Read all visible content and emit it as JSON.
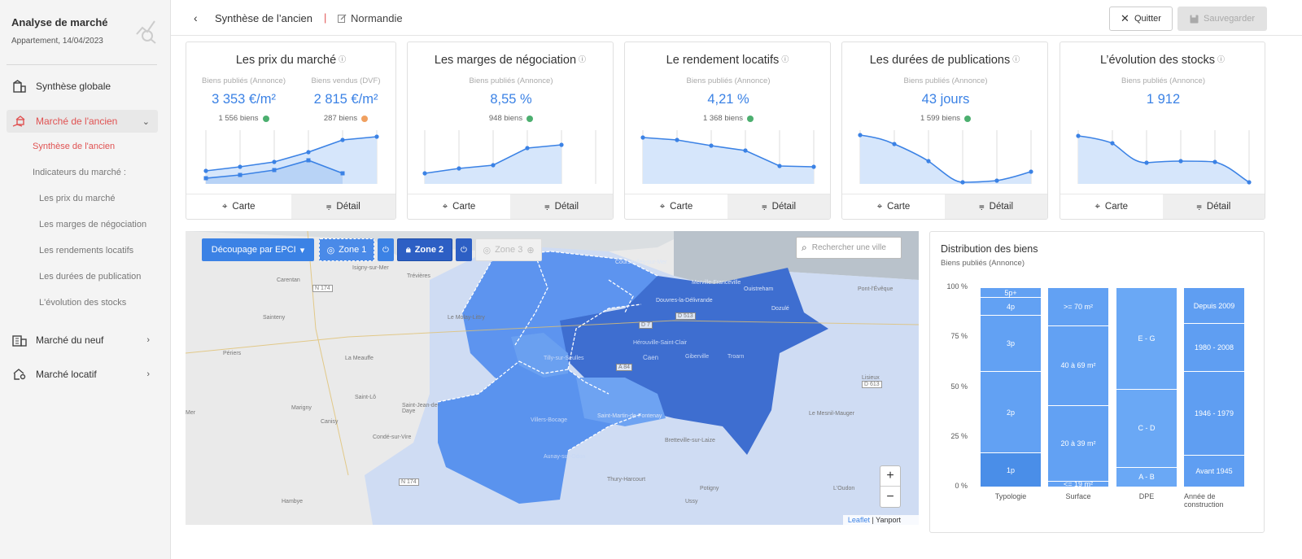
{
  "sidebar": {
    "app_title": "Analyse de marché",
    "app_subtitle": "Appartement, 14/04/2023",
    "items": [
      {
        "label": "Synthèse globale",
        "icon": "building-icon"
      },
      {
        "label": "Marché de l'ancien",
        "icon": "house-hand-icon",
        "active": true
      },
      {
        "label": "Marché du neuf",
        "icon": "city-icon"
      },
      {
        "label": "Marché locatif",
        "icon": "house-key-icon"
      }
    ],
    "sub_active": "Synthèse de l'ancien",
    "sub_header": "Indicateurs du marché :",
    "sub_items": [
      "Les prix du marché",
      "Les marges de négociation",
      "Les rendements locatifs",
      "Les durées de publication",
      "L'évolution des stocks"
    ]
  },
  "header": {
    "back_icon": "chevron-left-icon",
    "title": "Synthèse de l’ancien",
    "separator": "|",
    "region": "Normandie",
    "quit_label": "Quitter",
    "save_label": "Sauvegarder"
  },
  "cards": [
    {
      "title": "Les prix du marché",
      "cols": [
        {
          "label": "Biens publiés (Annonce)",
          "value": "3 353 €/m²",
          "count": "1 556 biens",
          "dot": "#4caf6f"
        },
        {
          "label": "Biens vendus (DVF)",
          "value": "2 815 €/m²",
          "count": "287 biens",
          "dot": "#f0a060"
        }
      ]
    },
    {
      "title": "Les marges de négociation",
      "cols": [
        {
          "label": "Biens publiés (Annonce)",
          "value": "8,55 %",
          "count": "948 biens",
          "dot": "#4caf6f"
        }
      ]
    },
    {
      "title": "Le rendement locatifs",
      "cols": [
        {
          "label": "Biens publiés (Annonce)",
          "value": "4,21 %",
          "count": "1 368 biens",
          "dot": "#4caf6f"
        }
      ]
    },
    {
      "title": "Les durées de publications",
      "cols": [
        {
          "label": "Biens publiés (Annonce)",
          "value": "43 jours",
          "count": "1 599 biens",
          "dot": "#4caf6f"
        }
      ]
    },
    {
      "title": "L’évolution des stocks",
      "cols": [
        {
          "label": "Biens publiés (Annonce)",
          "value": "1 912",
          "count": "",
          "dot": ""
        }
      ]
    }
  ],
  "card_footer": {
    "map_label": "Carte",
    "detail_label": "Détail"
  },
  "map": {
    "split_label": "Découpage par EPCI",
    "zone1": "Zone 1",
    "zone2": "Zone 2",
    "zone3": "Zone 3",
    "search_placeholder": "Rechercher une ville",
    "zoom_in": "+",
    "zoom_out": "−",
    "attrib_leaflet": "Leaflet",
    "attrib_sep": " | ",
    "attrib_yanport": "Yanport",
    "labels": [
      "Isigny-sur-Mer",
      "Carentan",
      "N 174",
      "Trévières",
      "Sainteny",
      "Le Molay-Littry",
      "Périers",
      "La Meauffe",
      "Saint-Lô",
      "Marigny",
      "Canisy",
      "Saint-Jean-de-Daye",
      "Condé-sur-Vire",
      "Tilly-sur-Seulles",
      "Villers-Bocage",
      "Aunay-sur-Odon",
      "Thury-Harcourt",
      "Potigny",
      "Ussy",
      "Hambye",
      "N 174",
      "Courseulles-sur-Mer",
      "Ouistreham",
      "Douvres-la-Délivrande",
      "Caen",
      "Hérouville-Saint-Clair",
      "Giberville",
      "Troarn",
      "D 513",
      "Saint-Martin-de-Fontenay",
      "Bretteville-sur-Laize",
      "Pont-l'Évêque",
      "Lisieux",
      "D 613",
      "Le Mesnil-Mauger",
      "L'Oudon",
      "Dozulé",
      "Merville-Franceville",
      "Mer",
      "A 84",
      "D 7"
    ]
  },
  "chart_data": {
    "type": "bar",
    "title": "Distribution des biens",
    "subtitle": "Biens publiés (Annonce)",
    "stacked": true,
    "ylim": [
      0,
      100
    ],
    "yticks": [
      "0 %",
      "25 %",
      "50 %",
      "75 %",
      "100 %"
    ],
    "categories": [
      "Typologie",
      "Surface",
      "DPE",
      "Année de construction"
    ],
    "bars": [
      {
        "category": "Typologie",
        "segments": [
          {
            "label": "1p",
            "value": 17
          },
          {
            "label": "2p",
            "value": 41
          },
          {
            "label": "3p",
            "value": 28
          },
          {
            "label": "4p",
            "value": 9
          },
          {
            "label": "5p+",
            "value": 5
          }
        ]
      },
      {
        "category": "Surface",
        "segments": [
          {
            "label": "<= 19 m²",
            "value": 3
          },
          {
            "label": "20 à 39 m²",
            "value": 38
          },
          {
            "label": "40 à 69 m²",
            "value": 40
          },
          {
            "label": ">= 70 m²",
            "value": 19
          }
        ]
      },
      {
        "category": "DPE",
        "segments": [
          {
            "label": "A - B",
            "value": 10
          },
          {
            "label": "C - D",
            "value": 39
          },
          {
            "label": "E - G",
            "value": 51
          }
        ]
      },
      {
        "category": "Année de construction",
        "segments": [
          {
            "label": "Avant 1945",
            "value": 16
          },
          {
            "label": "1946 - 1979",
            "value": 42
          },
          {
            "label": "1980 - 2008",
            "value": 24
          },
          {
            "label": "Depuis 2009",
            "value": 18
          }
        ]
      }
    ]
  },
  "colors": {
    "accent": "#3b82e5",
    "active_red": "#e05252",
    "bar_blue": "#62a1f3",
    "zone_light": "#5b95f0",
    "zone_dark": "#3d6fd1"
  }
}
